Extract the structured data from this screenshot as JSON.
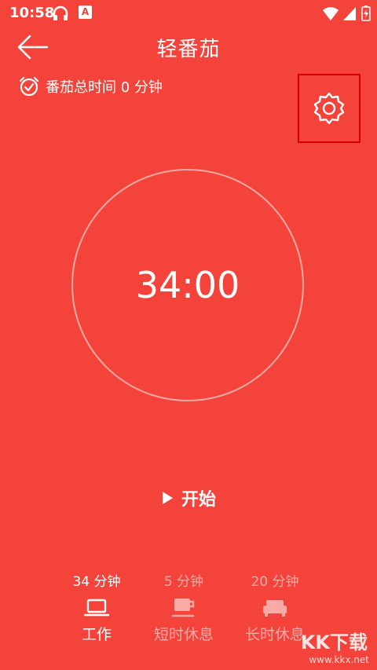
{
  "status_bar": {
    "time": "10:58",
    "notification_letter": "A"
  },
  "app_bar": {
    "title": "轻番茄"
  },
  "summary": {
    "total_text": "番茄总时间 0 分钟"
  },
  "timer": {
    "display": "34:00"
  },
  "start_button": {
    "label": "开始"
  },
  "tabs": [
    {
      "duration": "34 分钟",
      "label": "工作",
      "icon": "laptop-icon",
      "active": true
    },
    {
      "duration": "5 分钟",
      "label": "短时休息",
      "icon": "coffee-cup-icon",
      "active": false
    },
    {
      "duration": "20 分钟",
      "label": "长时休息",
      "icon": "sofa-icon",
      "active": false
    }
  ],
  "watermark": {
    "big": "KK下载",
    "url": "www.kkx.net"
  },
  "colors": {
    "background": "#f4433a",
    "highlight_box": "#d40000"
  }
}
